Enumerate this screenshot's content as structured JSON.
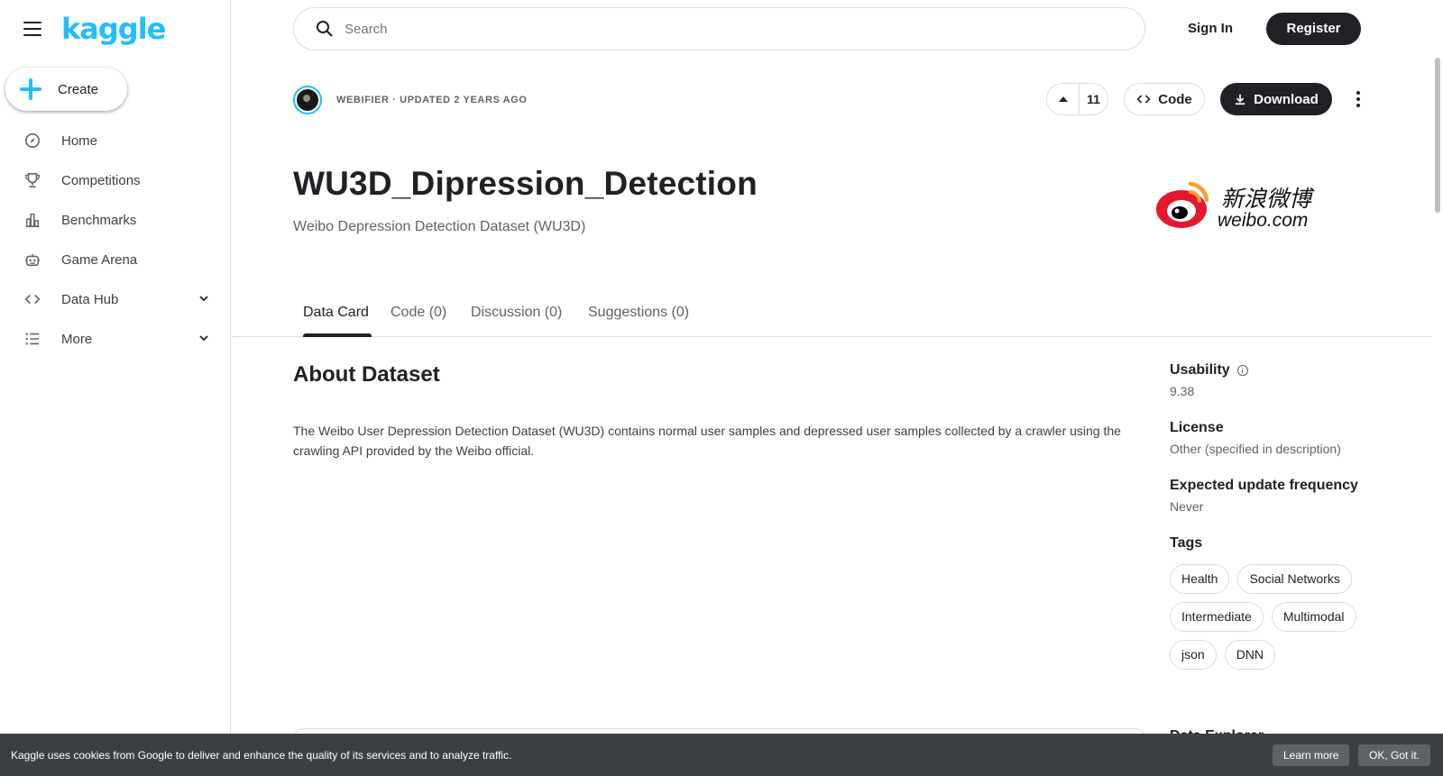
{
  "sidebar": {
    "logo": "kaggle",
    "create_label": "Create",
    "items": [
      {
        "label": "Home",
        "icon": "compass-icon"
      },
      {
        "label": "Competitions",
        "icon": "trophy-icon"
      },
      {
        "label": "Benchmarks",
        "icon": "bar-chart-icon"
      },
      {
        "label": "Game Arena",
        "icon": "robot-icon"
      },
      {
        "label": "Data Hub",
        "icon": "code-icon"
      },
      {
        "label": "More",
        "icon": "list-icon"
      }
    ]
  },
  "header": {
    "search_placeholder": "Search",
    "signin_label": "Sign In",
    "register_label": "Register"
  },
  "dataset": {
    "owner_line": "WEBIFIER · UPDATED 2 YEARS AGO",
    "vote_count": "11",
    "code_label": "Code",
    "download_label": "Download",
    "title": "WU3D_Dipression_Detection",
    "subtitle": "Weibo Depression Detection Dataset (WU3D)",
    "logo_cn": "新浪微博",
    "logo_en": "weibo.com"
  },
  "tabs": [
    {
      "label": "Data Card"
    },
    {
      "label": "Code (0)"
    },
    {
      "label": "Discussion (0)"
    },
    {
      "label": "Suggestions (0)"
    }
  ],
  "about": {
    "title": "About Dataset",
    "text": "The Weibo User Depression Detection Dataset (WU3D) contains normal user samples and depressed user samples collected by a crawler using the crawling API provided by the Weibo official."
  },
  "meta": {
    "usability_label": "Usability",
    "usability_value": "9.38",
    "license_label": "License",
    "license_value": "Other (specified in description)",
    "frequency_label": "Expected update frequency",
    "frequency_value": "Never",
    "tags_label": "Tags",
    "tags": [
      "Health",
      "Social Networks",
      "Intermediate",
      "Multimodal",
      "json",
      "DNN"
    ],
    "data_explorer_label": "Data Explorer"
  },
  "cookie": {
    "text": "Kaggle uses cookies from Google to deliver and enhance the quality of its services and to analyze traffic.",
    "learn_more": "Learn more",
    "ok": "OK, Got it."
  },
  "colors": {
    "accent": "#20beff",
    "dark": "#202124",
    "weibo_red": "#e6162d",
    "weibo_orange": "#ff9933"
  }
}
